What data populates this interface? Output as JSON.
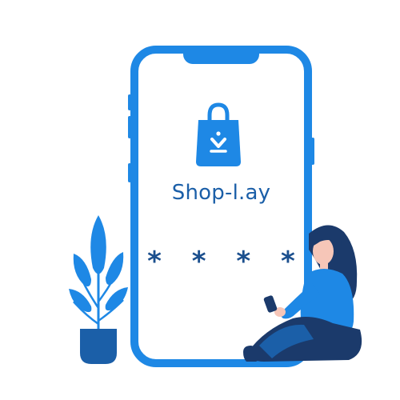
{
  "app": {
    "name": "Shop-l.ay",
    "pin_mask": "* * * *"
  },
  "icons": {
    "logo": "shopping-bag-icon",
    "plant": "potted-plant-icon",
    "person": "woman-with-phone-icon"
  },
  "colors": {
    "brand_blue": "#1e88e5",
    "title_blue": "#1b5fa8",
    "dark_navy": "#1b3a6b",
    "skin": "#f6c6b8"
  }
}
